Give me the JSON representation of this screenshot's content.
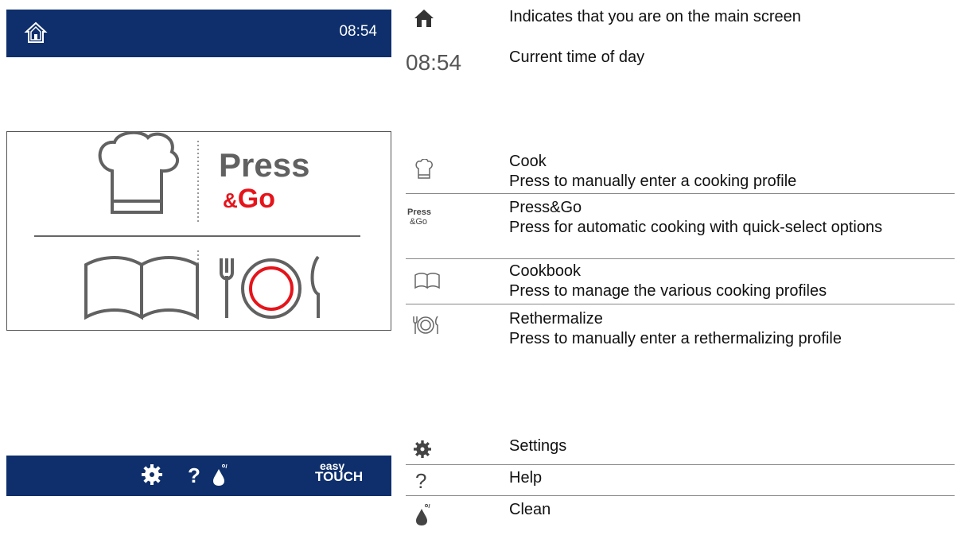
{
  "top_bar": {
    "time": "08:54",
    "icon": "home-icon"
  },
  "main_panel": {
    "press_word": "Press",
    "go_amp": "&",
    "go_word": "Go",
    "colors": {
      "go": "#e5141b",
      "press": "#616161",
      "plate_ring": "#e5141b"
    }
  },
  "bottom_bar": {
    "easy": "easy",
    "touch": "TOUCH",
    "help_glyph": "?"
  },
  "legend": {
    "home": {
      "text": "Indicates that you are on the main screen"
    },
    "clock": {
      "time": "08:54",
      "text": "Current time of day"
    },
    "cook": {
      "title": "Cook",
      "desc": "Press to manually enter a cooking profile"
    },
    "pressgo": {
      "icon_press": "Press",
      "icon_go": "&Go",
      "title": "Press&Go",
      "desc": "Press for automatic cooking with quick-select options"
    },
    "cookbook": {
      "title": "Cookbook",
      "desc": "Press to manage the various cooking profiles"
    },
    "reth": {
      "title": "Rethermalize",
      "desc": "Press to manually enter a rethermalizing profile"
    },
    "settings": {
      "text": "Settings"
    },
    "help": {
      "glyph": "?",
      "text": "Help"
    },
    "clean": {
      "text": "Clean"
    }
  },
  "colors": {
    "bar": "#0e2f6b"
  }
}
